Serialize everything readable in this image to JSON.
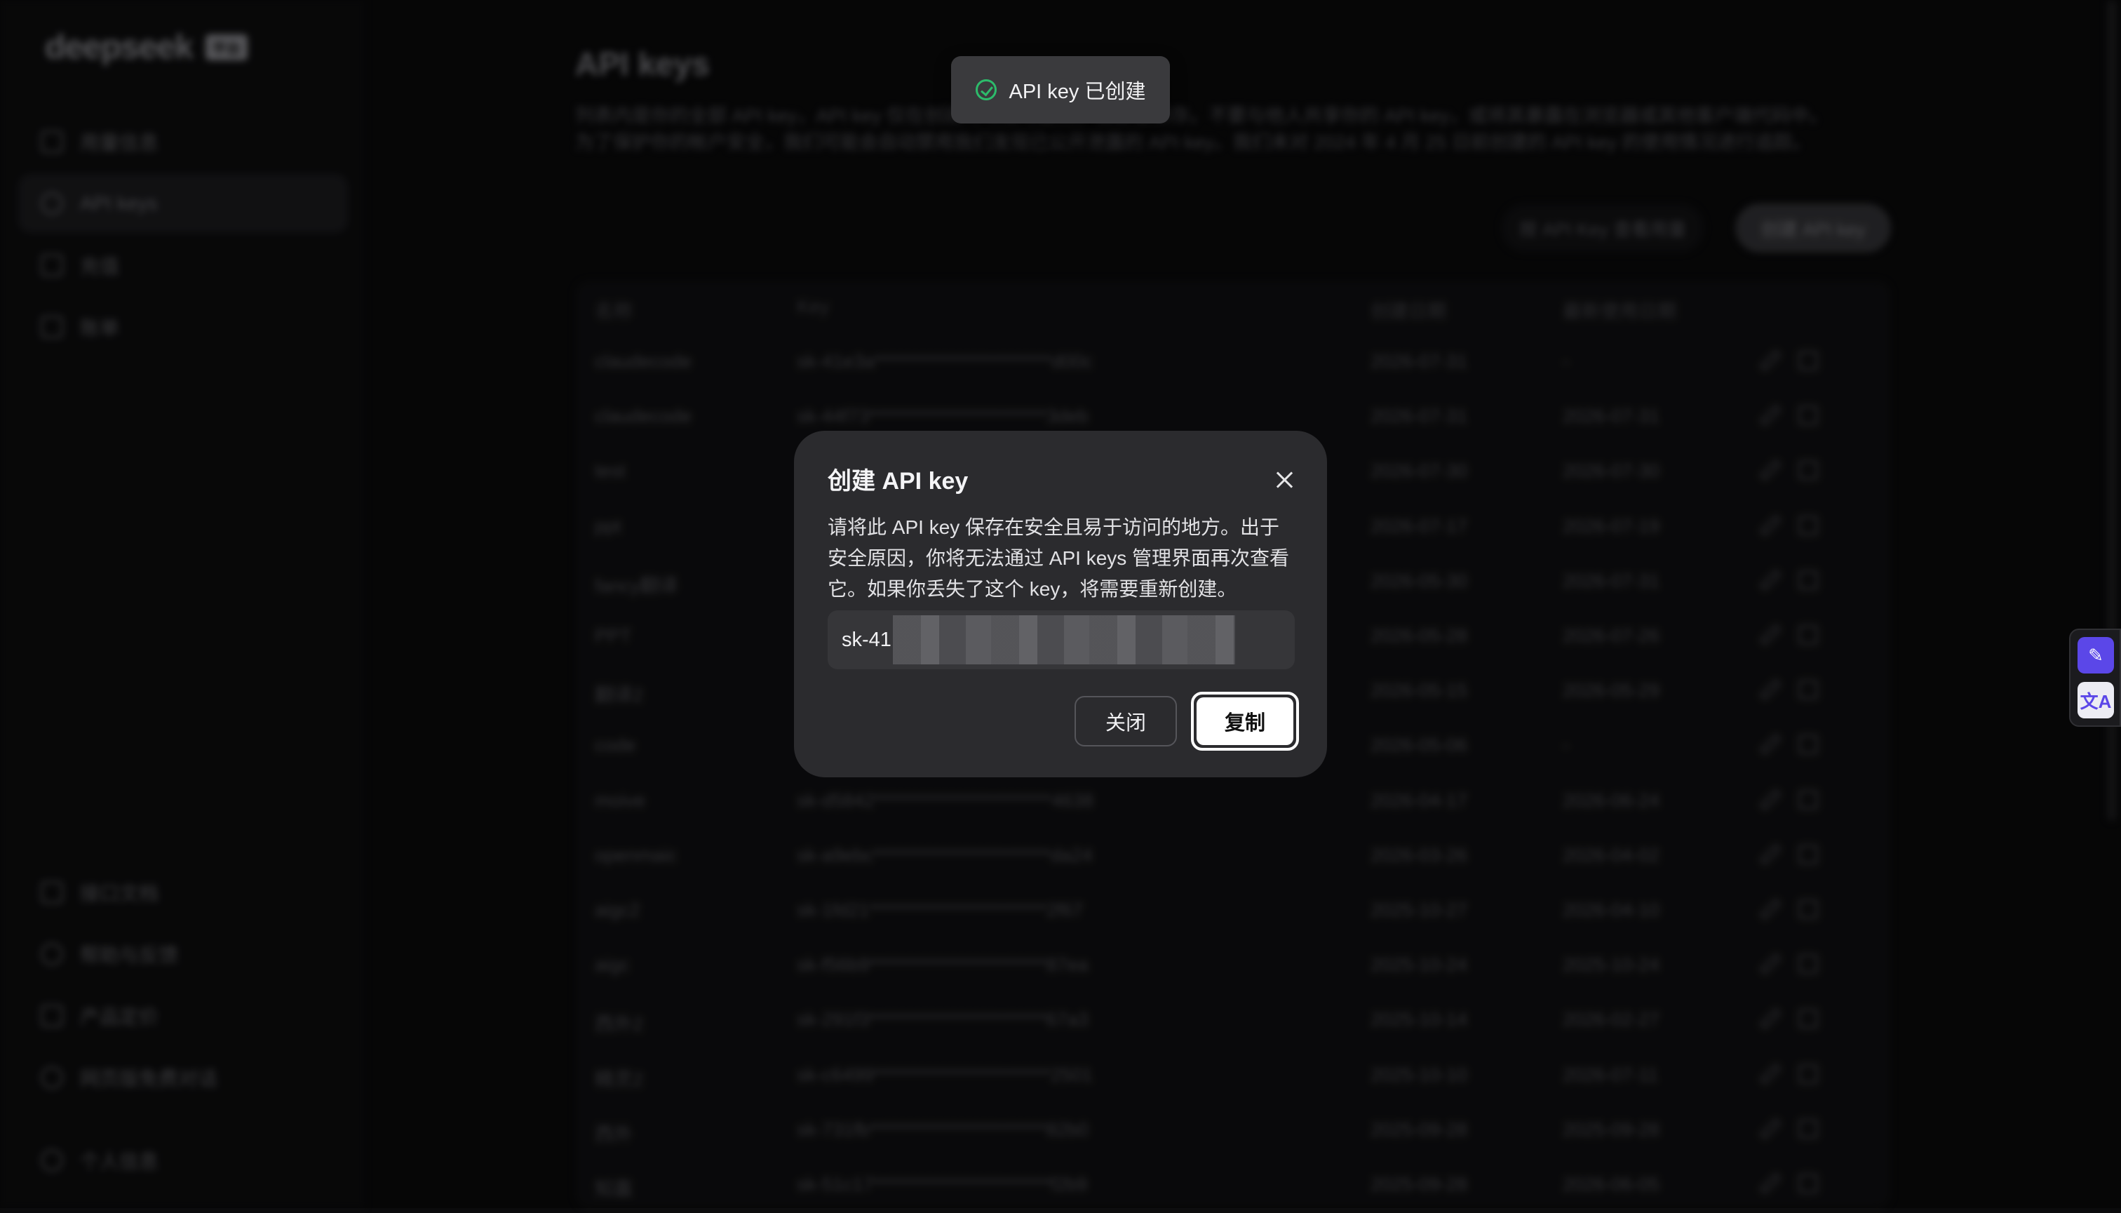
{
  "brand": {
    "logo": "deepseek",
    "badge": "平台"
  },
  "sidebar": {
    "items": [
      {
        "label": "用量信息",
        "icon": "bar-chart-icon"
      },
      {
        "label": "API keys",
        "icon": "search-icon"
      },
      {
        "label": "充值",
        "icon": "wallet-icon"
      },
      {
        "label": "账单",
        "icon": "bill-icon"
      }
    ],
    "bottom_items": [
      {
        "label": "接口文档",
        "icon": "doc-icon"
      },
      {
        "label": "帮助与反馈",
        "icon": "help-icon"
      },
      {
        "label": "产品定价",
        "icon": "tag-icon"
      },
      {
        "label": "网页版免费对话",
        "icon": "chat-icon"
      }
    ],
    "profile": {
      "label": "个人信息",
      "icon": "user-icon"
    }
  },
  "main": {
    "title": "API keys",
    "description_line1": "列表内是你的全部 API key，API key 仅在创建时可见可复制，请妥善保存。不要与他人共享你的 API key，或将其暴露在浏览器或其他客户端代码中。",
    "description_line2": "为了保护你的帐户安全，我们可能会自动禁用我们发现已公开泄露的 API key。我们未对 2024 年 4 月 25 日前创建的 API key 的使用情况进行追踪。",
    "usage_by_key_button": "按 API Key 查看用量",
    "create_button": "创建 API key"
  },
  "table": {
    "headers": {
      "name": "名称",
      "key": "Key",
      "created": "创建日期",
      "last_used": "最新使用日期"
    },
    "rows": [
      {
        "name": "claudecode",
        "key": "sk-41e3a************************d00c",
        "created": "2026-07-31",
        "last_used": "-"
      },
      {
        "name": "claudecode",
        "key": "sk-44f73************************3deb",
        "created": "2026-07-31",
        "last_used": "2026-07-31"
      },
      {
        "name": "test",
        "key": "",
        "created": "2026-07-30",
        "last_used": "2026-07-30"
      },
      {
        "name": "ppt",
        "key": "",
        "created": "2026-07-17",
        "last_used": "2026-07-19"
      },
      {
        "name": "fancy翻译",
        "key": "",
        "created": "2026-05-30",
        "last_used": "2026-07-31"
      },
      {
        "name": "PPT",
        "key": "",
        "created": "2026-05-28",
        "last_used": "2026-07-26"
      },
      {
        "name": "翻译2",
        "key": "",
        "created": "2026-05-15",
        "last_used": "2026-05-29"
      },
      {
        "name": "code",
        "key": "",
        "created": "2026-05-06",
        "last_used": "-"
      },
      {
        "name": "moive",
        "key": "sk-d5842************************4638",
        "created": "2026-04-17",
        "last_used": "2026-06-24"
      },
      {
        "name": "openmaic",
        "key": "sk-a9ebc************************da24",
        "created": "2026-03-26",
        "last_used": "2026-04-02"
      },
      {
        "name": "aigc2",
        "key": "sk-1fd21************************2f67",
        "created": "2025-10-27",
        "last_used": "2026-04-10"
      },
      {
        "name": "aigc",
        "key": "sk-f56b9************************87ea",
        "created": "2025-10-24",
        "last_used": "2025-10-24"
      },
      {
        "name": "西外2",
        "key": "sk-291f3************************67a3",
        "created": "2025-10-14",
        "last_used": "2026-02-27"
      },
      {
        "name": "精灵2",
        "key": "sk-c6499************************2501",
        "created": "2025-10-10",
        "last_used": "2026-07-11"
      },
      {
        "name": "西外",
        "key": "sk-731fb************************82b0",
        "created": "2025-09-28",
        "last_used": "2025-09-28"
      },
      {
        "name": "知嘉",
        "key": "sk-51c17************************f2b9",
        "created": "2025-09-28",
        "last_used": "2026-06-05"
      }
    ]
  },
  "toast": {
    "text": "API key 已创建"
  },
  "modal": {
    "title": "创建 API key",
    "body_line1": "请将此 API key 保存在安全且易于访问的地方。出于",
    "body_line2": "安全原因，你将无法通过 API keys 管理界面再次查看",
    "body_line3": "它。如果你丢失了这个 key，将需要重新创建。",
    "key_prefix": "sk-41",
    "close_button": "关闭",
    "copy_button": "复制"
  },
  "float_toolbar": {
    "translate_label": "文A"
  },
  "colors": {
    "accent": "#5b47e8",
    "success": "#2dbb6b",
    "modal_bg": "#2b2b2e"
  }
}
